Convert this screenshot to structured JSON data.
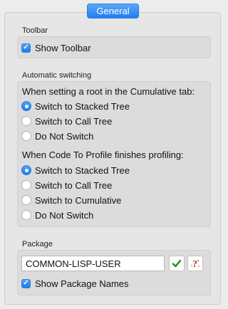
{
  "tab": {
    "label": "General"
  },
  "toolbar": {
    "group_label": "Toolbar",
    "show_toolbar": {
      "label": "Show Toolbar",
      "checked": true
    }
  },
  "switching": {
    "group_label": "Automatic switching",
    "cumulative_heading": "When setting a root in the Cumulative tab:",
    "cumulative_options": [
      {
        "label": "Switch to Stacked Tree",
        "selected": true
      },
      {
        "label": "Switch to Call Tree",
        "selected": false
      },
      {
        "label": "Do Not Switch",
        "selected": false
      }
    ],
    "profile_heading": "When Code To Profile finishes profiling:",
    "profile_options": [
      {
        "label": "Switch to Stacked Tree",
        "selected": true
      },
      {
        "label": "Switch to Call Tree",
        "selected": false
      },
      {
        "label": "Switch to Cumulative",
        "selected": false
      },
      {
        "label": "Do Not Switch",
        "selected": false
      }
    ]
  },
  "package": {
    "group_label": "Package",
    "input_value": "COMMON-LISP-USER",
    "show_names": {
      "label": "Show Package Names",
      "checked": true
    }
  },
  "colors": {
    "accent": "#1f7ff0",
    "panel": "#dcdcdc",
    "window": "#ececec"
  },
  "icons": {
    "confirm": "green-checkmark-icon",
    "help": "red-question-icon"
  }
}
